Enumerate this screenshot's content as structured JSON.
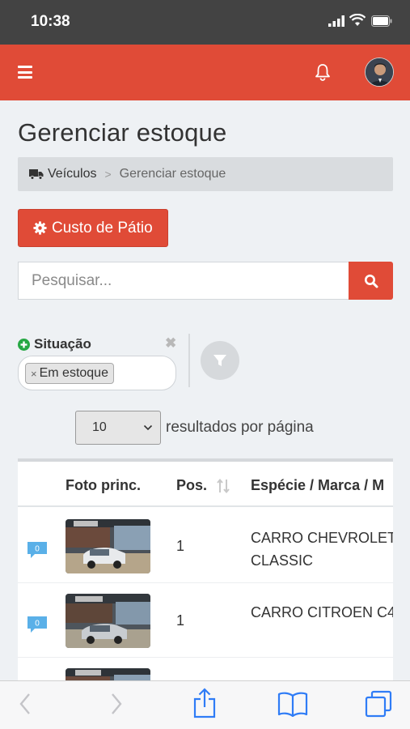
{
  "status_bar": {
    "time": "10:38"
  },
  "header": {
    "accent_color": "#e04b37",
    "menu_icon": "hamburger-icon",
    "notification_icon": "bell-icon"
  },
  "page": {
    "title": "Gerenciar estoque"
  },
  "breadcrumb": {
    "items": [
      {
        "label": "Veículos",
        "icon": "truck-icon"
      },
      {
        "label": "Gerenciar estoque"
      }
    ],
    "separator": ">"
  },
  "actions": {
    "custo_label": "Custo de Pátio",
    "custo_icon": "gear-icon"
  },
  "search": {
    "placeholder": "Pesquisar..."
  },
  "filter": {
    "label": "Situação",
    "tags": [
      "Em estoque"
    ],
    "remove_symbol": "✖",
    "tag_remove_symbol": "×"
  },
  "pagination": {
    "page_size": "10",
    "label": "resultados por página"
  },
  "table": {
    "headers": {
      "foto": "Foto princ.",
      "pos": "Pos.",
      "especie": "Espécie / Marca / M"
    },
    "rows": [
      {
        "chat_count": "0",
        "pos": "1",
        "desc_line1": "CARRO CHEVROLET",
        "desc_line2": "CLASSIC"
      },
      {
        "chat_count": "0",
        "pos": "1",
        "desc_line1": "CARRO CITROEN C4",
        "desc_line2": ""
      }
    ]
  }
}
